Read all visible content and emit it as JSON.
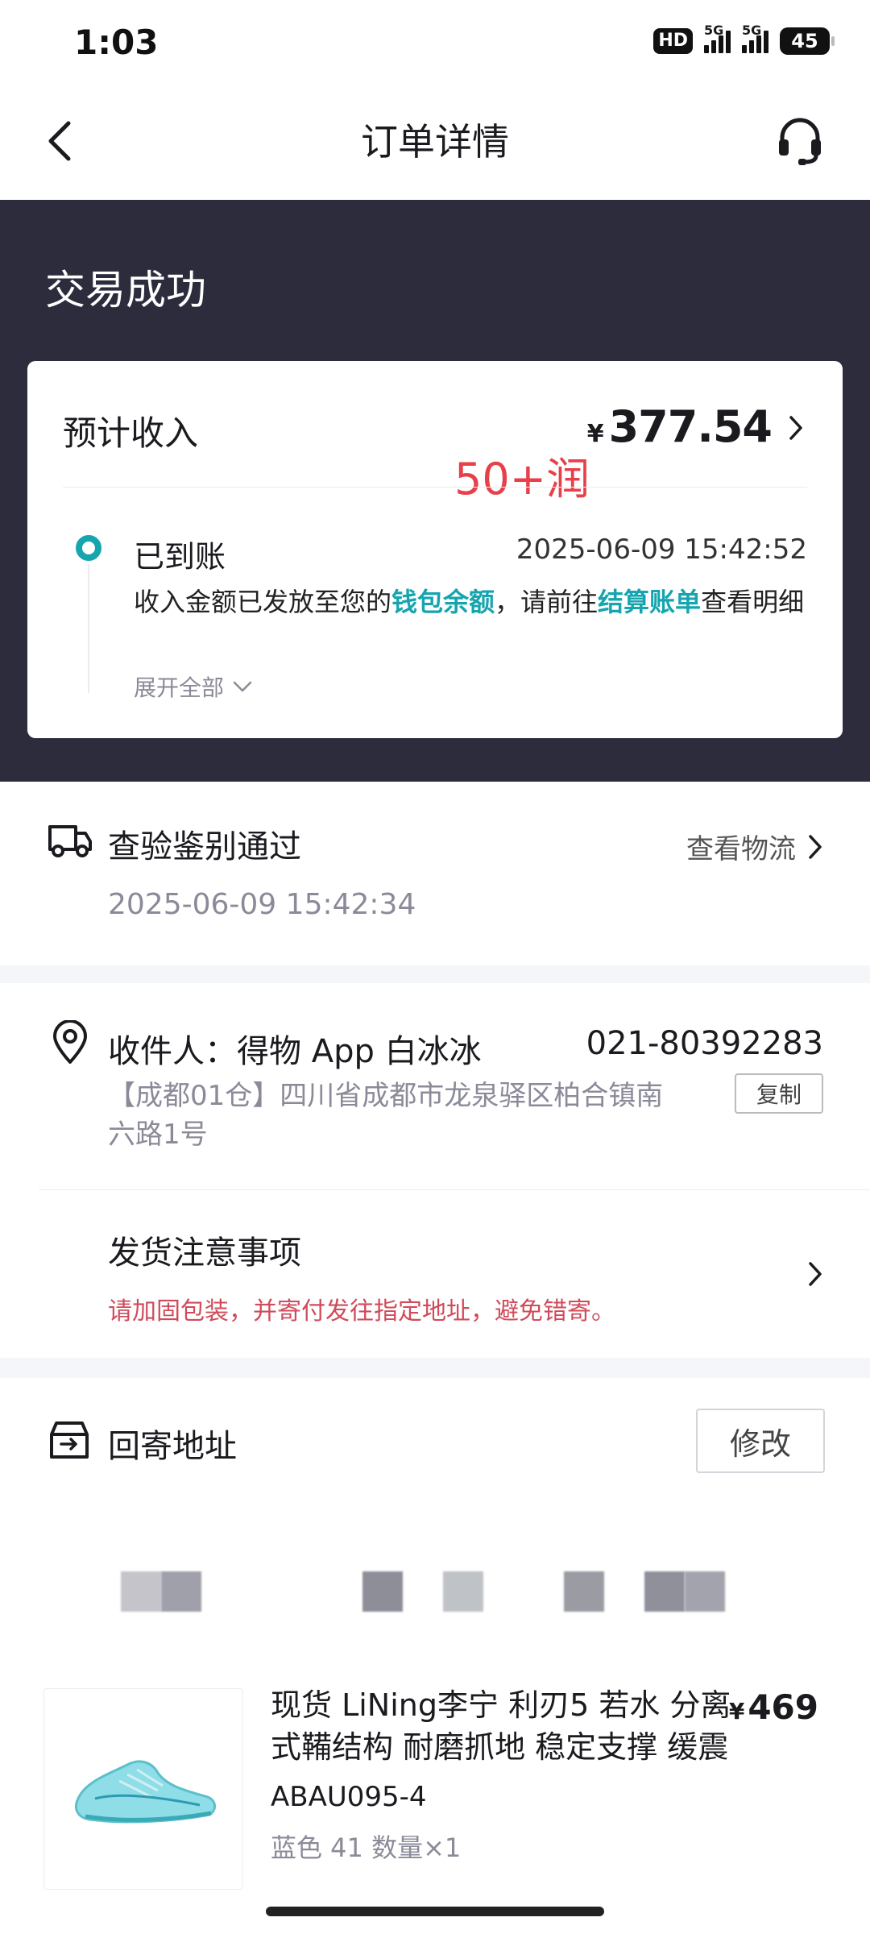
{
  "status_bar": {
    "time": "1:03",
    "hd_label": "HD",
    "signal1_label": "5G",
    "signal2_label": "5G",
    "battery": "45"
  },
  "header": {
    "title": "订单详情"
  },
  "banner": {
    "status": "交易成功"
  },
  "income": {
    "label": "预计收入",
    "currency": "¥",
    "amount": "377.54",
    "annotation": "50+润",
    "timeline": {
      "title": "已到账",
      "time": "2025-06-09 15:42:52",
      "desc_prefix": "收入金额已发放至您的",
      "desc_link1": "钱包余额",
      "desc_mid": "，请前往",
      "desc_link2": "结算账单",
      "desc_suffix": "查看明细",
      "expand_label": "展开全部"
    }
  },
  "inspection": {
    "title": "查验鉴别通过",
    "link": "查看物流",
    "time": "2025-06-09 15:42:34"
  },
  "receiver": {
    "name": "收件人：得物 App 白冰冰",
    "phone": "021-80392283",
    "address": "【成都01仓】四川省成都市龙泉驿区柏合镇南六路1号",
    "copy_label": "复制",
    "notice_title": "发货注意事项",
    "notice_desc": "请加固包装，并寄付发往指定地址，避免错寄。"
  },
  "return_address": {
    "title": "回寄地址",
    "edit_label": "修改"
  },
  "product": {
    "name": "现货 LiNing李宁 利刃5 若水 分离式鞴结构 耐磨抓地 稳定支撑 缓震",
    "currency": "¥",
    "price": "469",
    "sku": "ABAU095-4",
    "spec": "蓝色 41 数量×1"
  },
  "colors": {
    "accent": "#16a5af",
    "banner_bg": "#2c2c3d",
    "warning_text": "#d04b5b",
    "annotation": "#e8404b"
  }
}
